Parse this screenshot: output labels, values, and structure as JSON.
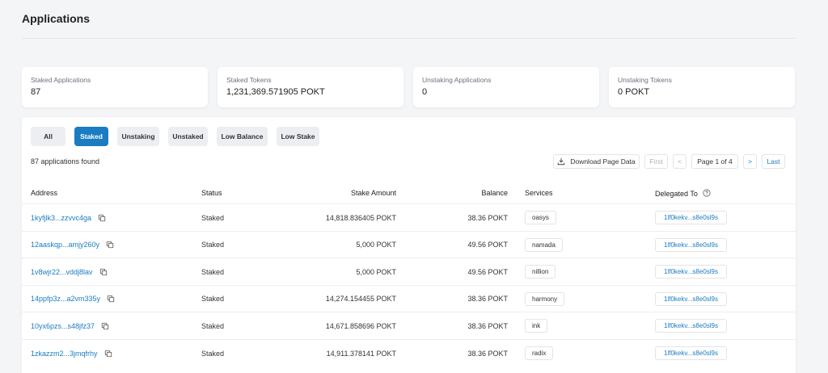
{
  "page_title": "Applications",
  "stats": [
    {
      "label": "Staked Applications",
      "value": "87"
    },
    {
      "label": "Staked Tokens",
      "value": "1,231,369.571905 POKT"
    },
    {
      "label": "Unstaking Applications",
      "value": "0"
    },
    {
      "label": "Unstaking Tokens",
      "value": "0 POKT"
    }
  ],
  "filters": [
    {
      "label": "All",
      "active": false
    },
    {
      "label": "Staked",
      "active": true
    },
    {
      "label": "Unstaking",
      "active": false
    },
    {
      "label": "Unstaked",
      "active": false
    },
    {
      "label": "Low Balance",
      "active": false
    },
    {
      "label": "Low Stake",
      "active": false
    }
  ],
  "found_text": "87 applications found",
  "pager": {
    "download": "Download Page Data",
    "first": "First",
    "prev": "<",
    "page": "Page 1 of 4",
    "next": ">",
    "last": "Last"
  },
  "columns": {
    "address": "Address",
    "status": "Status",
    "stake": "Stake Amount",
    "balance": "Balance",
    "services": "Services",
    "delegated": "Delegated To"
  },
  "rows": [
    {
      "address": "1kyfjlk3...zzvvc4ga",
      "status": "Staked",
      "stake": "14,818.836405 POKT",
      "balance": "38.36 POKT",
      "service": "oasys",
      "delegated": "1lf0kekv...s8e0sl9s"
    },
    {
      "address": "12aaskqp...amjy260y",
      "status": "Staked",
      "stake": "5,000 POKT",
      "balance": "49.56 POKT",
      "service": "namada",
      "delegated": "1lf0kekv...s8e0sl9s"
    },
    {
      "address": "1v8wjr22...vddj8lav",
      "status": "Staked",
      "stake": "5,000 POKT",
      "balance": "49.56 POKT",
      "service": "nillion",
      "delegated": "1lf0kekv...s8e0sl9s"
    },
    {
      "address": "14ppfp3z...a2vm335y",
      "status": "Staked",
      "stake": "14,274.154455 POKT",
      "balance": "38.36 POKT",
      "service": "harmony",
      "delegated": "1lf0kekv...s8e0sl9s"
    },
    {
      "address": "10yx6pzs...s48jfz37",
      "status": "Staked",
      "stake": "14,671.858696 POKT",
      "balance": "38.36 POKT",
      "service": "ink",
      "delegated": "1lf0kekv...s8e0sl9s"
    },
    {
      "address": "1zkazzm2...3jmqfrhy",
      "status": "Staked",
      "stake": "14,911.378141 POKT",
      "balance": "38.36 POKT",
      "service": "radix",
      "delegated": "1lf0kekv...s8e0sl9s"
    }
  ]
}
